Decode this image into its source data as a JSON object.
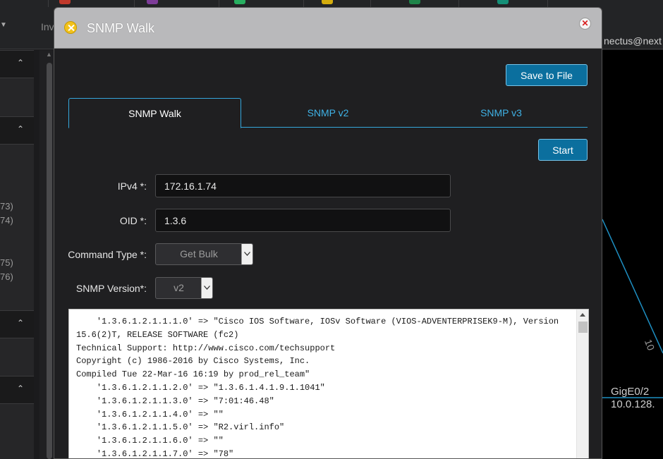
{
  "background": {
    "topbar": {
      "nav_fragment": "Inv"
    },
    "user_fragment": "nectus@next",
    "sidebar_fragments": [
      "73)",
      "74)",
      "75)",
      "76)"
    ],
    "canvas": {
      "interface_label": "GigE0/2",
      "ip_fragment": "10.0.128.",
      "vertical_fragment": "10"
    },
    "toolbar_icon_colors": [
      "#c0392b",
      "#7d3c98",
      "#27ae60",
      "#d4ac0d",
      "#1e8449",
      "#148f77"
    ]
  },
  "dialog": {
    "title": "SNMP Walk",
    "save_label": "Save to File",
    "start_label": "Start",
    "tabs": [
      {
        "label": "SNMP Walk",
        "active": true
      },
      {
        "label": "SNMP v2",
        "active": false
      },
      {
        "label": "SNMP v3",
        "active": false
      }
    ],
    "form": {
      "ipv4_label": "IPv4 *:",
      "ipv4_value": "172.16.1.74",
      "oid_label": "OID *:",
      "oid_value": "1.3.6",
      "command_type_label": "Command Type *:",
      "command_type_value": "Get Bulk",
      "snmp_version_label": "SNMP Version*:",
      "snmp_version_value": "v2"
    },
    "output_lines": [
      "    '1.3.6.1.2.1.1.1.0' => \"Cisco IOS Software, IOSv Software (VIOS-ADVENTERPRISEK9-M), Version 15.6(2)T, RELEASE SOFTWARE (fc2)",
      "Technical Support: http://www.cisco.com/techsupport",
      "Copyright (c) 1986-2016 by Cisco Systems, Inc.",
      "Compiled Tue 22-Mar-16 16:19 by prod_rel_team\"",
      "    '1.3.6.1.2.1.1.2.0' => \"1.3.6.1.4.1.9.1.1041\"",
      "    '1.3.6.1.2.1.1.3.0' => \"7:01:46.48\"",
      "    '1.3.6.1.2.1.1.4.0' => \"\"",
      "    '1.3.6.1.2.1.1.5.0' => \"R2.virl.info\"",
      "    '1.3.6.1.2.1.1.6.0' => \"\"",
      "    '1.3.6.1.2.1.1.7.0' => \"78\""
    ],
    "colors": {
      "accent": "#35a7dc",
      "button": "#0b6f9e",
      "header": "#b9b9bb"
    }
  }
}
